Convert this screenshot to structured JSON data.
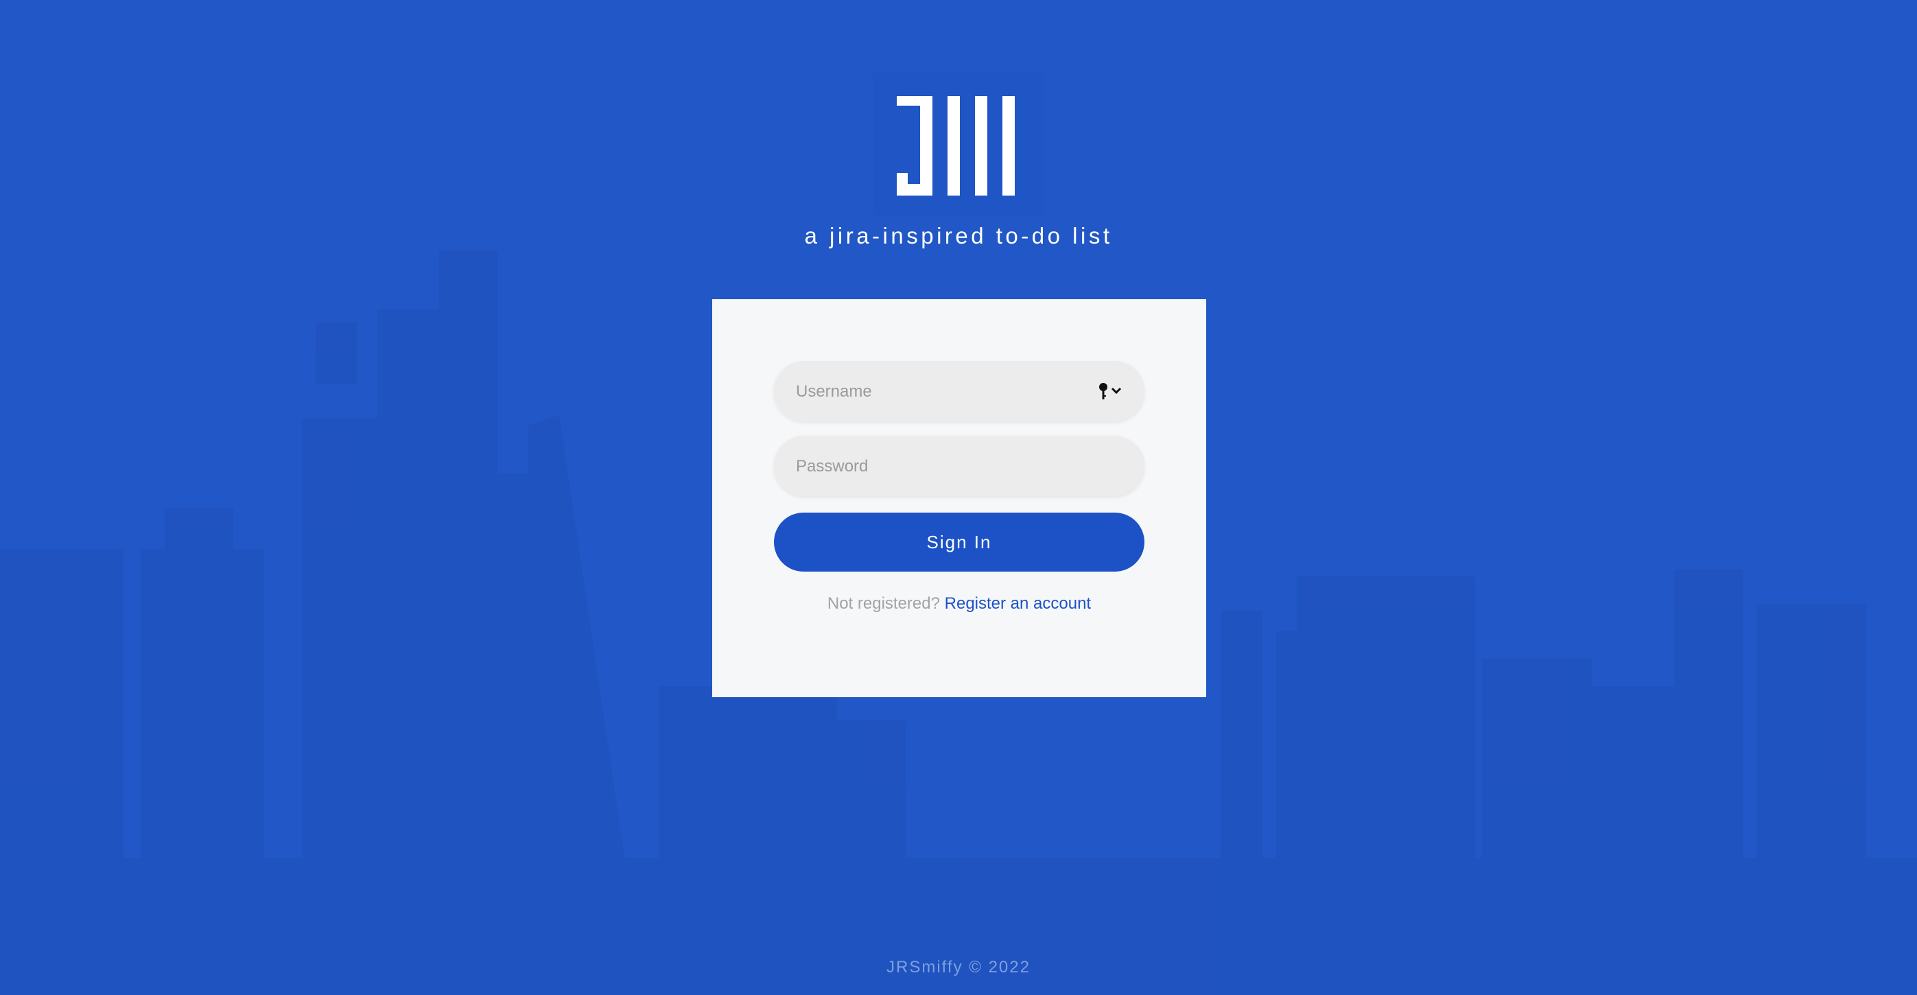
{
  "page": {
    "background_color": "#2157c6",
    "accent_color": "#1c52c6"
  },
  "logo": {
    "alt": "JIII",
    "icon": "jiii-logo"
  },
  "header": {
    "tagline": "a jira-inspired to-do list"
  },
  "login_form": {
    "username_placeholder": "Username",
    "username_value": "",
    "password_placeholder": "Password",
    "password_value": "",
    "password_manager_icon": "key-dropdown-icon",
    "signin_label": "Sign In",
    "register_prompt": "Not registered?",
    "register_link": "Register an account"
  },
  "footer": {
    "text": "JRSmiffy © 2022"
  }
}
